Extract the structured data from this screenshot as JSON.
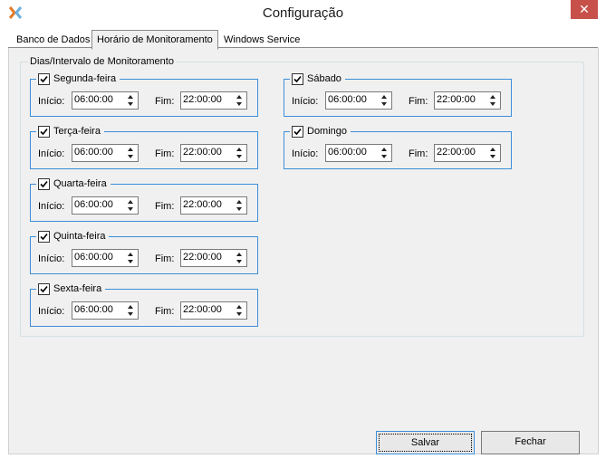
{
  "window": {
    "title": "Configuração",
    "close_glyph": "✕",
    "accent": "#3c8fdb"
  },
  "tabs": [
    {
      "label": "Banco de Dados",
      "active": false
    },
    {
      "label": "Horário de Monitoramento",
      "active": true
    },
    {
      "label": "Windows Service",
      "active": false
    }
  ],
  "group": {
    "title": "Dias/Intervalo de Monitoramento"
  },
  "labels": {
    "start": "Início:",
    "end": "Fim:"
  },
  "days": [
    {
      "name": "Segunda-feira",
      "checked": true,
      "start": "06:00:00",
      "end": "22:00:00"
    },
    {
      "name": "Terça-feira",
      "checked": true,
      "start": "06:00:00",
      "end": "22:00:00"
    },
    {
      "name": "Quarta-feira",
      "checked": true,
      "start": "06:00:00",
      "end": "22:00:00"
    },
    {
      "name": "Quinta-feira",
      "checked": true,
      "start": "06:00:00",
      "end": "22:00:00"
    },
    {
      "name": "Sexta-feira",
      "checked": true,
      "start": "06:00:00",
      "end": "22:00:00"
    },
    {
      "name": "Sábado",
      "checked": true,
      "start": "06:00:00",
      "end": "22:00:00"
    },
    {
      "name": "Domingo",
      "checked": true,
      "start": "06:00:00",
      "end": "22:00:00"
    }
  ],
  "buttons": {
    "save": "Salvar",
    "close": "Fechar"
  }
}
